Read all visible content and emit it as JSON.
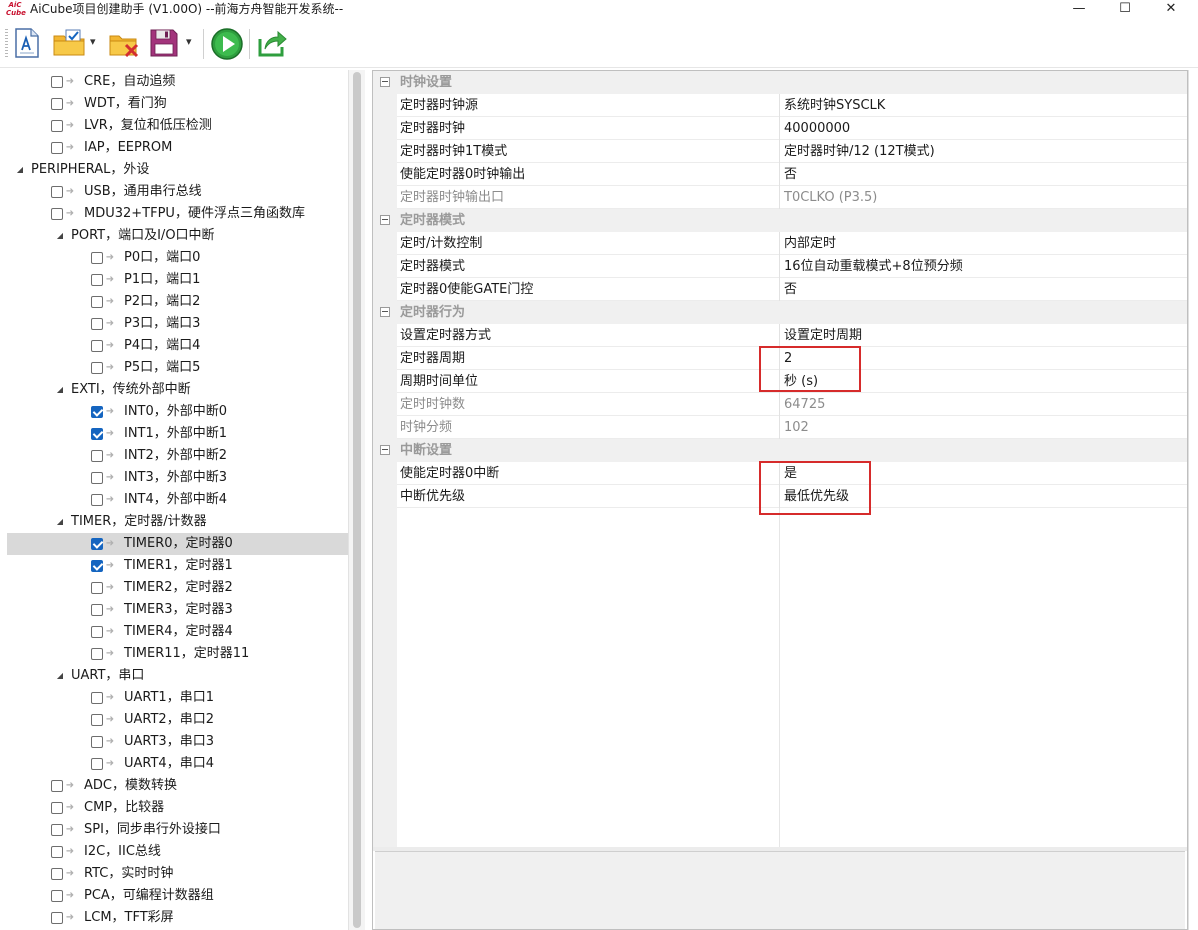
{
  "window": {
    "title": "AiCube项目创建助手 (V1.00O) --前海方舟智能开发系统--",
    "icon_text": [
      "AiC",
      "Cube"
    ],
    "minimize_glyph": "—",
    "maximize_glyph": "☐",
    "close_glyph": "✕"
  },
  "toolbar": {
    "items": [
      {
        "name": "new-file-icon"
      },
      {
        "name": "open-folder-icon"
      },
      {
        "name": "close-folder-icon"
      },
      {
        "name": "save-icon"
      },
      {
        "name": "run-icon"
      },
      {
        "name": "export-icon"
      }
    ],
    "dropdown_glyph": "▾"
  },
  "tree": {
    "expander_glyph": "◢",
    "arrow_glyph": "➜",
    "items": [
      {
        "label": "CRE，自动追频",
        "level": 1,
        "checked": false
      },
      {
        "label": "WDT，看门狗",
        "level": 1,
        "checked": false
      },
      {
        "label": "LVR，复位和低压检测",
        "level": 1,
        "checked": false
      },
      {
        "label": "IAP，EEPROM",
        "level": 1,
        "checked": false
      },
      {
        "label": "PERIPHERAL，外设",
        "level": 0,
        "group": true
      },
      {
        "label": "USB，通用串行总线",
        "level": 1,
        "checked": false
      },
      {
        "label": "MDU32+TFPU，硬件浮点三角函数库",
        "level": 1,
        "checked": false
      },
      {
        "label": "PORT，端口及I/O口中断",
        "level": 1,
        "group": true
      },
      {
        "label": "P0口，端口0",
        "level": 2,
        "checked": false
      },
      {
        "label": "P1口，端口1",
        "level": 2,
        "checked": false
      },
      {
        "label": "P2口，端口2",
        "level": 2,
        "checked": false
      },
      {
        "label": "P3口，端口3",
        "level": 2,
        "checked": false
      },
      {
        "label": "P4口，端口4",
        "level": 2,
        "checked": false
      },
      {
        "label": "P5口，端口5",
        "level": 2,
        "checked": false
      },
      {
        "label": "EXTI，传统外部中断",
        "level": 1,
        "group": true
      },
      {
        "label": "INT0，外部中断0",
        "level": 2,
        "checked": true
      },
      {
        "label": "INT1，外部中断1",
        "level": 2,
        "checked": true
      },
      {
        "label": "INT2，外部中断2",
        "level": 2,
        "checked": false
      },
      {
        "label": "INT3，外部中断3",
        "level": 2,
        "checked": false
      },
      {
        "label": "INT4，外部中断4",
        "level": 2,
        "checked": false
      },
      {
        "label": "TIMER，定时器/计数器",
        "level": 1,
        "group": true
      },
      {
        "label": "TIMER0，定时器0",
        "level": 2,
        "checked": true,
        "selected": true
      },
      {
        "label": "TIMER1，定时器1",
        "level": 2,
        "checked": true
      },
      {
        "label": "TIMER2，定时器2",
        "level": 2,
        "checked": false
      },
      {
        "label": "TIMER3，定时器3",
        "level": 2,
        "checked": false
      },
      {
        "label": "TIMER4，定时器4",
        "level": 2,
        "checked": false
      },
      {
        "label": "TIMER11，定时器11",
        "level": 2,
        "checked": false
      },
      {
        "label": "UART，串口",
        "level": 1,
        "group": true
      },
      {
        "label": "UART1，串口1",
        "level": 2,
        "checked": false
      },
      {
        "label": "UART2，串口2",
        "level": 2,
        "checked": false
      },
      {
        "label": "UART3，串口3",
        "level": 2,
        "checked": false
      },
      {
        "label": "UART4，串口4",
        "level": 2,
        "checked": false
      },
      {
        "label": "ADC，模数转换",
        "level": 1,
        "checked": false
      },
      {
        "label": "CMP，比较器",
        "level": 1,
        "checked": false
      },
      {
        "label": "SPI，同步串行外设接口",
        "level": 1,
        "checked": false
      },
      {
        "label": "I2C，IIC总线",
        "level": 1,
        "checked": false
      },
      {
        "label": "RTC，实时时钟",
        "level": 1,
        "checked": false
      },
      {
        "label": "PCA，可编程计数器组",
        "level": 1,
        "checked": false
      },
      {
        "label": "LCM，TFT彩屏",
        "level": 1,
        "checked": false
      }
    ]
  },
  "properties": {
    "rows": [
      {
        "type": "category",
        "label": "时钟设置"
      },
      {
        "type": "prop",
        "name": "定时器时钟源",
        "value": "系统时钟SYSCLK"
      },
      {
        "type": "prop",
        "name": "定时器时钟",
        "value": "40000000"
      },
      {
        "type": "prop",
        "name": "定时器时钟1T模式",
        "value": "定时器时钟/12 (12T模式)"
      },
      {
        "type": "prop",
        "name": "使能定时器0时钟输出",
        "value": "否"
      },
      {
        "type": "prop",
        "name": "定时器时钟输出口",
        "value": "T0CLKO (P3.5)",
        "disabled": true
      },
      {
        "type": "category",
        "label": "定时器模式"
      },
      {
        "type": "prop",
        "name": "定时/计数控制",
        "value": "内部定时"
      },
      {
        "type": "prop",
        "name": "定时器模式",
        "value": "16位自动重载模式+8位预分频"
      },
      {
        "type": "prop",
        "name": "定时器0使能GATE门控",
        "value": "否"
      },
      {
        "type": "category",
        "label": "定时器行为"
      },
      {
        "type": "prop",
        "name": "设置定时器方式",
        "value": "设置定时周期"
      },
      {
        "type": "prop",
        "name": "定时器周期",
        "value": "2"
      },
      {
        "type": "prop",
        "name": "周期时间单位",
        "value": "秒 (s)"
      },
      {
        "type": "prop",
        "name": "定时时钟数",
        "value": "64725",
        "disabled": true
      },
      {
        "type": "prop",
        "name": "时钟分频",
        "value": "102",
        "disabled": true
      },
      {
        "type": "category",
        "label": "中断设置"
      },
      {
        "type": "prop",
        "name": "使能定时器0中断",
        "value": "是"
      },
      {
        "type": "prop",
        "name": "中断优先级",
        "value": "最低优先级"
      }
    ],
    "description": ""
  },
  "colors": {
    "highlight": "#d62b2b",
    "checkbox_checked": "#1565c0",
    "selected_row": "#d9d9d9",
    "run_green": "#2e9e3e"
  }
}
